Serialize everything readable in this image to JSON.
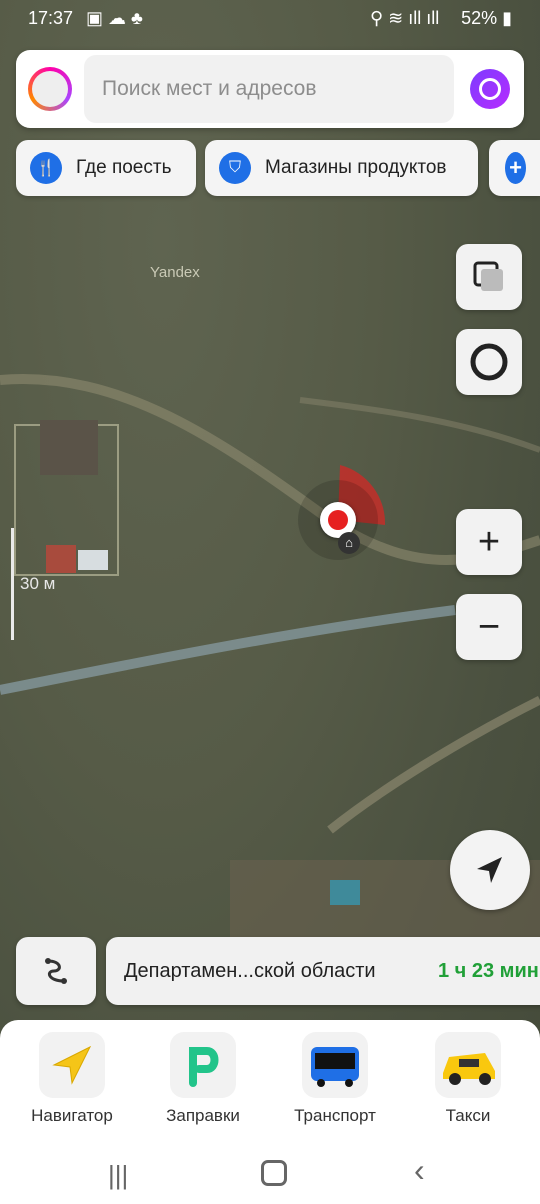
{
  "status_bar": {
    "time": "17:37",
    "battery": "52%"
  },
  "search": {
    "placeholder": "Поиск мест и адресов"
  },
  "chips": [
    {
      "label": "Где поесть",
      "icon": "fork-knife-icon"
    },
    {
      "label": "Магазины продуктов",
      "icon": "basket-icon"
    },
    {
      "label": "",
      "icon": "plus-icon"
    }
  ],
  "map": {
    "watermark": "Yandex",
    "scale_label": "30 м"
  },
  "destination": {
    "name": "Департамен...ской области",
    "time": "1 ч 23 мин"
  },
  "apps": [
    {
      "label": "Навигатор",
      "icon": "navigator-icon"
    },
    {
      "label": "Заправки",
      "icon": "fuel-icon"
    },
    {
      "label": "Транспорт",
      "icon": "bus-icon"
    },
    {
      "label": "Такси",
      "icon": "taxi-icon"
    }
  ],
  "colors": {
    "accent_blue": "#1f6fe6",
    "alice_purple": "#8a3cff",
    "eta_green": "#21a038",
    "location_red": "#e62020"
  }
}
